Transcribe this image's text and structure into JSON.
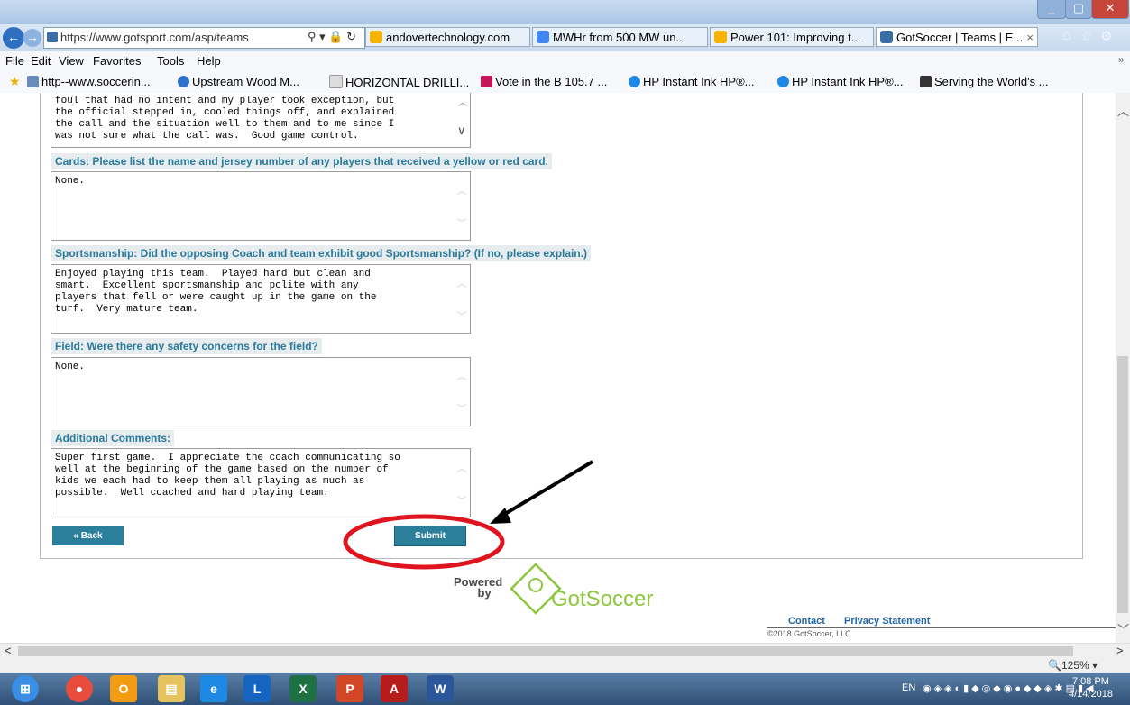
{
  "browser": {
    "address_url": "https://www.gotsport.com/asp/teams",
    "tabs": [
      {
        "label": "andovertechnology.com",
        "active": false
      },
      {
        "label": "MWHr from 500 MW un...",
        "active": false
      },
      {
        "label": "Power 101: Improving t...",
        "active": false
      },
      {
        "label": "GotSoccer | Teams | E...",
        "active": true
      }
    ],
    "tab_close": "×",
    "menu": [
      "File",
      "Edit",
      "View",
      "Favorites",
      "Tools",
      "Help"
    ],
    "favorites": [
      "http--www.soccerin...",
      "Upstream  Wood M...",
      "HORIZONTAL DRILLI...",
      "Vote in the B 105.7 ...",
      "HP Instant Ink  HP®...",
      "HP Instant Ink  HP®...",
      "Serving the World's ..."
    ],
    "zoom": "125%"
  },
  "form": {
    "prev_answer": "foul that had no intent and my player took exception, but\nthe official stepped in, cooled things off, and explained\nthe call and the situation well to them and to me since I\nwas not sure what the call was.  Good game control.",
    "questions": [
      {
        "label": "Cards: Please list the name and jersey number of any players that received a yellow or red card.",
        "answer": "None."
      },
      {
        "label": "Sportsmanship: Did the opposing Coach and team exhibit good Sportsmanship? (If no, please explain.)",
        "answer": "Enjoyed playing this team.  Played hard but clean and\nsmart.  Excellent sportsmanship and polite with any\nplayers that fell or were caught up in the game on the\nturf.  Very mature team."
      },
      {
        "label": "Field: Were there any safety concerns for the field?",
        "answer": "None."
      },
      {
        "label": "Additional Comments:",
        "answer": "Super first game.  I appreciate the coach communicating so\nwell at the beginning of the game based on the number of\nkids we each had to keep them all playing as much as\npossible.  Well coached and hard playing team."
      }
    ],
    "back_label": "« Back",
    "submit_label": "Submit"
  },
  "footer": {
    "powered": "Powered",
    "by": "by",
    "brand": "GotSoccer",
    "contact": "Contact",
    "privacy": "Privacy Statement",
    "copyright": "©2018 GotSoccer, LLC"
  },
  "taskbar": {
    "lang": "EN",
    "time": "7:08 PM",
    "date": "4/14/2018"
  },
  "colors": {
    "accent": "#2c7f9b",
    "annotation_red": "#e0141e"
  }
}
